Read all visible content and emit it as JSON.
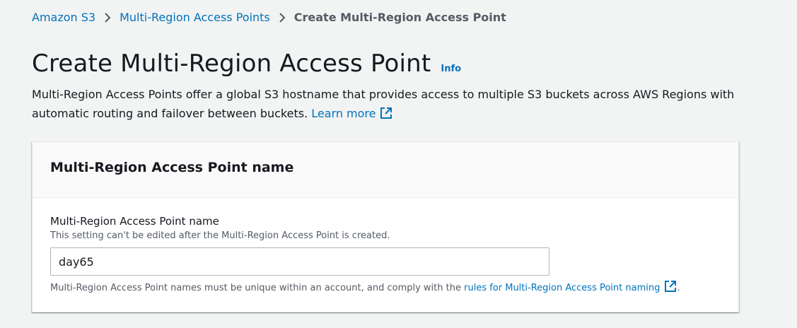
{
  "breadcrumb": {
    "items": [
      {
        "label": "Amazon S3"
      },
      {
        "label": "Multi-Region Access Points"
      },
      {
        "label": "Create Multi-Region Access Point"
      }
    ]
  },
  "page": {
    "title": "Create Multi-Region Access Point",
    "info_label": "Info",
    "description": "Multi-Region Access Points offer a global S3 hostname that provides access to multiple S3 buckets across AWS Regions with automatic routing and failover between buckets.",
    "learn_more_label": "Learn more"
  },
  "panel": {
    "title": "Multi-Region Access Point name",
    "field": {
      "label": "Multi-Region Access Point name",
      "description": "This setting can't be edited after the Multi-Region Access Point is created.",
      "value": "day65",
      "constraint_text": "Multi-Region Access Point names must be unique within an account, and comply with the",
      "rules_link_label": "rules for Multi-Region Access Point naming",
      "trailing": "."
    }
  },
  "colors": {
    "link": "#0073bb",
    "background": "#f2f3f3",
    "panel_header": "#fafafa",
    "text": "#16191f",
    "muted": "#545b64"
  },
  "icons": {
    "breadcrumb_separator": "chevron-right-icon",
    "external_link": "external-link-icon"
  }
}
